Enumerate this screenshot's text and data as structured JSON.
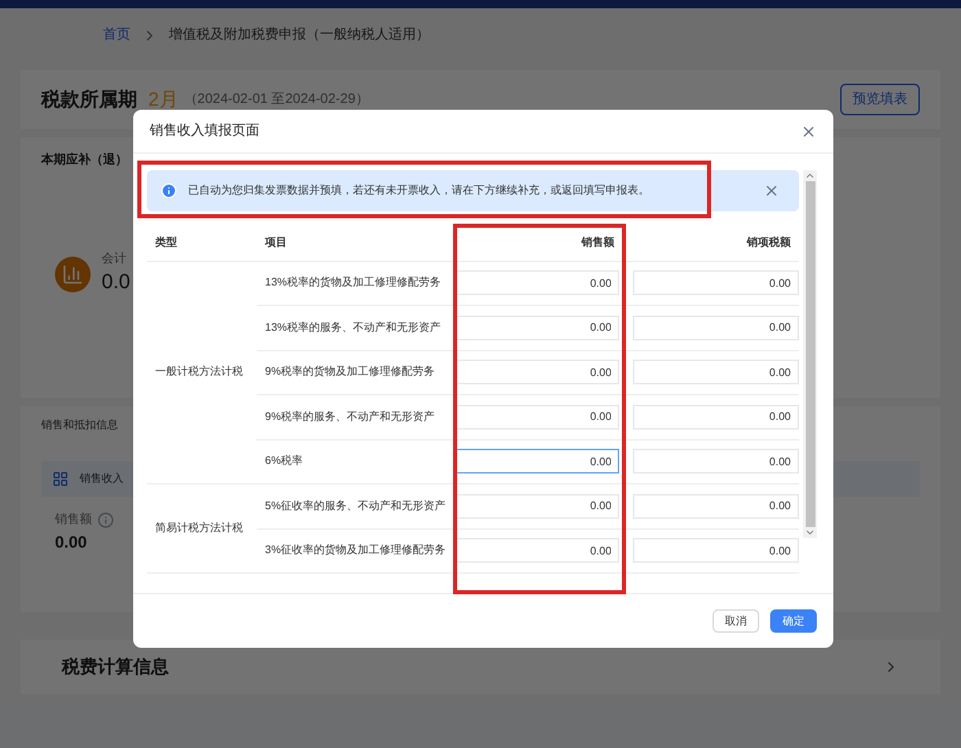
{
  "breadcrumb": [
    "首页",
    "增值税及附加税费申报（一般纳税人适用）"
  ],
  "period": {
    "label": "税款所属期",
    "month": "2月",
    "range": "（2024-02-01 至2024-02-29）",
    "button": "预览填表"
  },
  "summary": {
    "title": "本期应补（退）",
    "caption": "会计",
    "amount": "0.0"
  },
  "sales_section": {
    "title": "销售和抵扣信息",
    "tab": "销售收入",
    "field_label": "销售额",
    "field_value": "0.00"
  },
  "tax_section": {
    "title": "税费计算信息"
  },
  "modal": {
    "title": "销售收入填报页面",
    "alert": {
      "text": "已自动为您归集发票数据并预填，若还有未开票收入，请在下方继续补充，或返回填写申报表。",
      "highlighted": true
    },
    "columns": [
      {
        "label": "类型",
        "highlighted": false
      },
      {
        "label": "项目",
        "highlighted": false
      },
      {
        "label": "销售额",
        "highlighted": true
      },
      {
        "label": "销项税额",
        "highlighted": false
      }
    ],
    "groups": [
      {
        "type": "一般计税方法计税",
        "rows": [
          {
            "item": "13%税率的货物及加工修理修配劳务",
            "sales": "0.00",
            "tax": "0.00",
            "focused": false
          },
          {
            "item": "13%税率的服务、不动产和无形资产",
            "sales": "0.00",
            "tax": "0.00",
            "focused": false
          },
          {
            "item": "9%税率的货物及加工修理修配劳务",
            "sales": "0.00",
            "tax": "0.00",
            "focused": false
          },
          {
            "item": "9%税率的服务、不动产和无形资产",
            "sales": "0.00",
            "tax": "0.00",
            "focused": false
          },
          {
            "item": "6%税率",
            "sales": "0.00",
            "tax": "0.00",
            "focused": true
          }
        ]
      },
      {
        "type": "简易计税方法计税",
        "rows": [
          {
            "item": "5%征收率的服务、不动产和无形资产",
            "sales": "0.00",
            "tax": "0.00",
            "focused": false
          },
          {
            "item": "3%征收率的货物及加工修理修配劳务",
            "sales": "0.00",
            "tax": "0.00",
            "focused": false
          }
        ]
      }
    ],
    "buttons": [
      {
        "label": "取消",
        "kind": "secondary"
      },
      {
        "label": "确定",
        "kind": "primary"
      }
    ]
  }
}
